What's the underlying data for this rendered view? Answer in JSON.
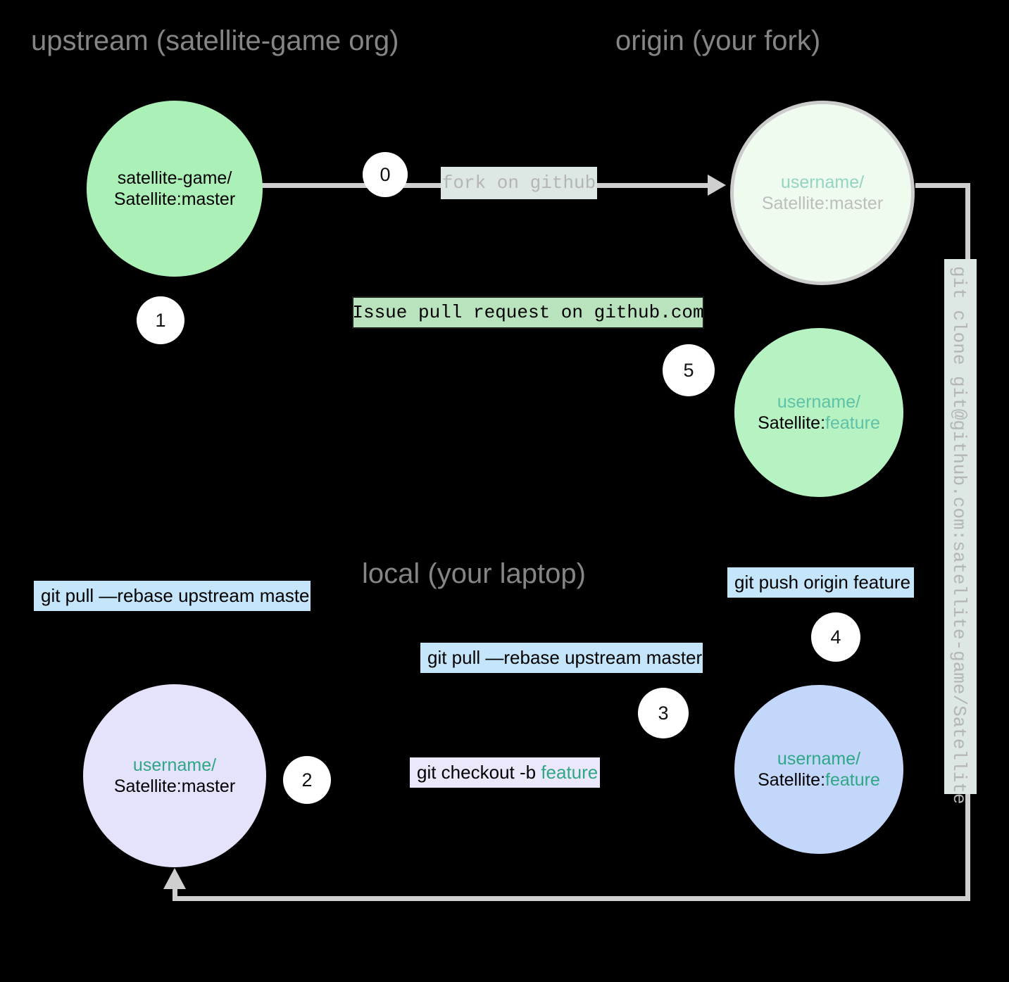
{
  "zones": {
    "upstream": "upstream (satellite-game org)",
    "origin": "origin (your fork)",
    "local": "local (your laptop)"
  },
  "nodes": {
    "upstream_master": {
      "owner": "satellite-game/",
      "repo": "Satellite:",
      "branch": "master"
    },
    "origin_master": {
      "owner": "username/",
      "repo": "Satellite:",
      "branch": "master"
    },
    "origin_feature": {
      "owner": "username/",
      "repo": "Satellite:",
      "branch": "feature"
    },
    "local_master": {
      "owner": "username/",
      "repo": "Satellite:",
      "branch": "master"
    },
    "local_feature": {
      "owner": "username/",
      "repo": "Satellite:",
      "branch": "feature"
    }
  },
  "steps": {
    "s0": "0",
    "s1": "1",
    "s2": "2",
    "s3": "3",
    "s4": "4",
    "s5": "5"
  },
  "commands": {
    "fork": "fork on github",
    "pull_request": "Issue pull request on github.com",
    "clone": "git clone git@github.com:satellite-game/Satellite",
    "rebase_left": "git pull —rebase upstream master",
    "rebase_mid": "git pull —rebase upstream master",
    "push": "git push origin feature",
    "checkout_prefix": "git checkout -b ",
    "checkout_branch": "feature"
  },
  "colors": {
    "background": "#000000",
    "zone_title": "#858585",
    "edge": "#cfcfcf",
    "upstream_green": "#abf0b6",
    "origin_faded_green": "#effbef",
    "origin_border": "#cccccc",
    "feature_green": "#b7f2c2",
    "local_lavender": "#e5e2fc",
    "local_blue": "#c3d7fb",
    "cmd_blue": "#c5e6fa",
    "cmd_green": "#b9e3bd",
    "cmd_lavender": "#ece8fb",
    "cmd_faded": "#dde7e3",
    "teal": "#2fa785",
    "teal_faded": "#93d5c3",
    "faded_text": "#c3c3c3",
    "text_black": "#000000"
  }
}
